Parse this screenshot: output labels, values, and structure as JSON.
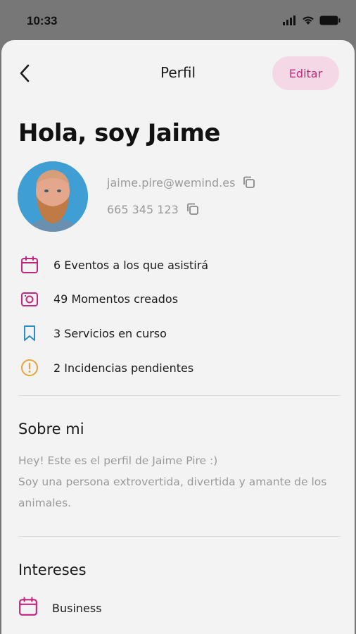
{
  "status_bar": {
    "time": "10:33"
  },
  "header": {
    "title": "Perfil",
    "edit_label": "Editar"
  },
  "profile": {
    "greeting": "Hola, soy Jaime",
    "email": "jaime.pire@wemind.es",
    "phone": "665 345 123"
  },
  "stats": [
    {
      "icon": "calendar-icon",
      "label": "6 Eventos a los que asistirá",
      "color": "#c2277d"
    },
    {
      "icon": "camera-icon",
      "label": "49 Momentos creados",
      "color": "#c2277d"
    },
    {
      "icon": "bookmark-icon",
      "label": "3 Servicios en curso",
      "color": "#2c8ec6"
    },
    {
      "icon": "alert-icon",
      "label": "2 Incidencias pendientes",
      "color": "#e8a33d"
    }
  ],
  "about": {
    "title": "Sobre mi",
    "line1": "Hey! Este es el perfil de Jaime Pire :)",
    "line2": "Soy una persona extrovertida, divertida y amante de los animales."
  },
  "interests": {
    "title": "Intereses",
    "items": [
      {
        "icon": "calendar-icon",
        "label": "Business"
      }
    ]
  },
  "colors": {
    "accent": "#c2277d",
    "accent_bg": "#f4d8e6",
    "blue": "#2c8ec6",
    "orange": "#e8a33d"
  }
}
